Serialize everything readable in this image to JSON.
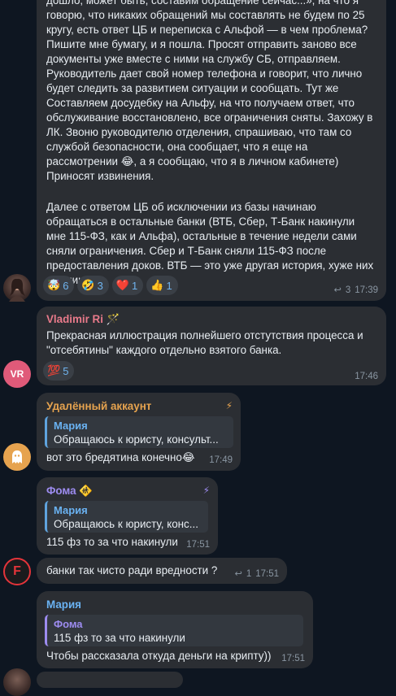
{
  "messages": {
    "m1": {
      "text1": "дошло, может быть, составим обращение сейчас...», на что я говорю, что никаких обращений мы составлять не будем по 25 кругу, есть ответ ЦБ и переписка с Альфой — в чем проблема? Пишите мне бумагу, и я пошла. Просят отправить заново все документы уже вместе с ними на службу СБ, отправляем. Руководитель дает свой номер телефона и говорит, что лично будет следить за развитием ситуации и сообщать. Тут же Составляем досудебку на Альфу, на что получаем ответ, что обслуживание восстановлено, все ограничения сняты. Захожу в ЛК. Звоню руководителю отделения, спрашиваю, что там со службой безопасности, она сообщает, что я еще на рассмотрении 😂, а я сообщаю, что я в личном кабинете) Приносят извинения.",
      "text2": "Далее с ответом ЦБ об исключении из базы начинаю обращаться в остальные банки (ВТБ, Сбер, Т-Банк накинули мне 115-ФЗ, как и Альфа), остальные в течение недели сами сняли ограничения. Сбер и Т-Банк сняли 115-ФЗ после предоставления доков. ВТБ — это уже другая история, хуже них нет никого.",
      "reactions": [
        {
          "emoji": "🤯",
          "count": "6"
        },
        {
          "emoji": "🤣",
          "count": "3"
        },
        {
          "emoji": "❤️",
          "count": "1"
        },
        {
          "emoji": "👍",
          "count": "1"
        }
      ],
      "replies": "3",
      "time": "17:39"
    },
    "m2": {
      "sender": "Vladimir Ri",
      "sender_emoji": "🪄",
      "avatar_initials": "VR",
      "text": "Прекрасная иллюстрация полнейшего отстутствия процесса и \"отсебятины\" каждого отдельно взятого банка.",
      "reactions": [
        {
          "emoji": "💯",
          "count": "5"
        }
      ],
      "time": "17:46"
    },
    "m3": {
      "sender": "Удалённый аккаунт",
      "quote_name": "Мария",
      "quote_text": "Обращаюсь к юристу, консульт...",
      "text": "вот это бредятина конечно😂",
      "time": "17:49"
    },
    "m4": {
      "sender": "Фома",
      "sender_emoji": "🚸",
      "quote_name": "Мария",
      "quote_text": "Обращаюсь к юристу, конс...",
      "text": "115 фз то за что накинули",
      "time": "17:51"
    },
    "m5": {
      "avatar_letter": "F",
      "text": "банки так чисто ради вредности ?",
      "replies": "1",
      "time": "17:51"
    },
    "m6": {
      "sender": "Мария",
      "quote_name": "Фома",
      "quote_text": "115 фз то за что накинули",
      "text": "Чтобы рассказала откуда деньги на крипту))",
      "time": "17:51"
    }
  },
  "colors": {
    "background": "#0e1621",
    "bubble": "#2b2e33",
    "link_blue": "#6ab2f2",
    "sender_vladimir": "#e87a8a",
    "sender_deleted": "#e6a34f",
    "sender_foma": "#9d8cf0",
    "sender_maria": "#6ab2f2"
  }
}
